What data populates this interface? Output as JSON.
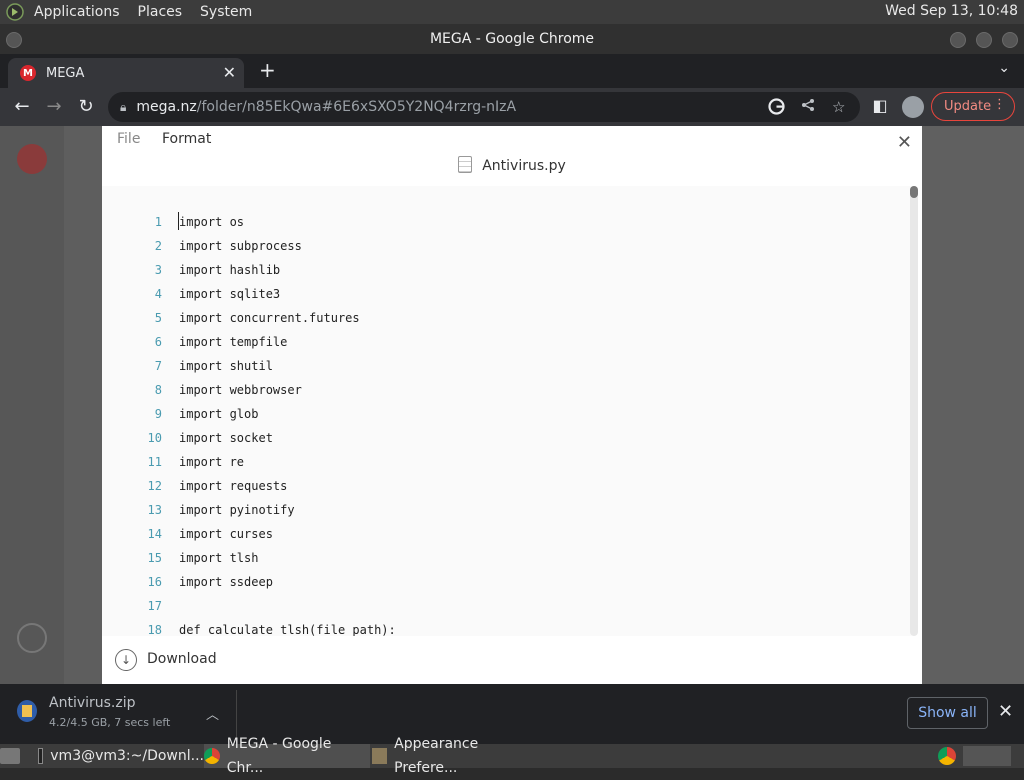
{
  "top_panel": {
    "menus": [
      "Applications",
      "Places",
      "System"
    ],
    "clock": "Wed Sep 13, 10:48"
  },
  "window": {
    "title": "MEGA - Google Chrome"
  },
  "browser": {
    "tab": {
      "title": "MEGA",
      "favicon_letter": "M"
    },
    "url": {
      "host": "mega.nz",
      "path": "/folder/n85EkQwa#6E6xSXO5Y2NQ4rzrg-nIzA"
    },
    "update_label": "Update"
  },
  "viewer": {
    "menu": {
      "file": "File",
      "format": "Format"
    },
    "file_name": "Antivirus.py",
    "lines": [
      {
        "n": "1",
        "code": "import os"
      },
      {
        "n": "2",
        "code": "import subprocess"
      },
      {
        "n": "3",
        "code": "import hashlib"
      },
      {
        "n": "4",
        "code": "import sqlite3"
      },
      {
        "n": "5",
        "code": "import concurrent.futures"
      },
      {
        "n": "6",
        "code": "import tempfile"
      },
      {
        "n": "7",
        "code": "import shutil"
      },
      {
        "n": "8",
        "code": "import webbrowser"
      },
      {
        "n": "9",
        "code": "import glob"
      },
      {
        "n": "10",
        "code": "import socket"
      },
      {
        "n": "11",
        "code": "import re"
      },
      {
        "n": "12",
        "code": "import requests"
      },
      {
        "n": "13",
        "code": "import pyinotify"
      },
      {
        "n": "14",
        "code": "import curses"
      },
      {
        "n": "15",
        "code": "import tlsh"
      },
      {
        "n": "16",
        "code": "import ssdeep"
      },
      {
        "n": "17",
        "code": ""
      },
      {
        "n": "18",
        "code": "def calculate_tlsh(file_path):"
      }
    ],
    "download_label": "Download"
  },
  "downloads_shelf": {
    "file_name": "Antivirus.zip",
    "status": "4.2/4.5 GB, 7 secs left",
    "show_all_label": "Show all"
  },
  "taskbar": {
    "tasks": [
      {
        "label": "vm3@vm3:~/Downl..."
      },
      {
        "label": "MEGA - Google Chr..."
      },
      {
        "label": "Appearance Prefere..."
      }
    ]
  },
  "colors": {
    "mega_red": "#d9272e",
    "update_red": "#e8453c",
    "line_number": "#4a9bb0",
    "link_blue": "#8ab4f8"
  }
}
